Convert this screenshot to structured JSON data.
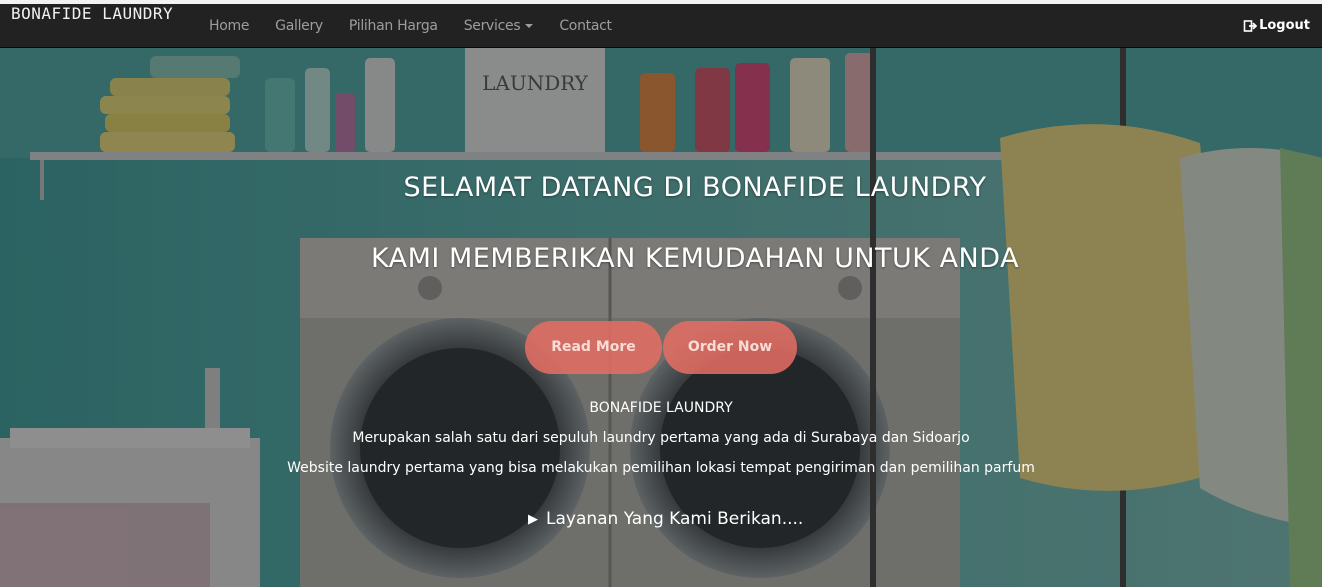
{
  "navbar": {
    "brand": "BONAFIDE LAUNDRY",
    "items": [
      {
        "label": "Home"
      },
      {
        "label": "Gallery"
      },
      {
        "label": "Pilihan Harga"
      },
      {
        "label": "Services"
      },
      {
        "label": "Contact"
      }
    ],
    "logout_label": "Logout"
  },
  "hero": {
    "bg_image_label": "LAUNDRY",
    "title_1": "SELAMAT DATANG DI BONAFIDE LAUNDRY",
    "title_2": "KAMI MEMBERIKAN KEMUDAHAN UNTUK ANDA",
    "read_more_label": "Read More",
    "order_now_label": "Order Now",
    "info_name": "BONAFIDE LAUNDRY",
    "info_line_1": "Merupakan salah satu dari sepuluh laundry pertama yang ada di Surabaya dan Sidoarjo",
    "info_line_2": "Website laundry pertama yang bisa melakukan pemilihan lokasi tempat pengiriman dan pemilihan parfum",
    "services_summary": "Layanan Yang Kami Berikan...."
  },
  "colors": {
    "navbar_bg": "#222222",
    "button_bg": "#e66e64",
    "nav_text": "#9d9d9d"
  },
  "icons": {
    "logout": "logout-icon",
    "caret": "chevron-down-icon",
    "summary": "triangle-right-icon"
  }
}
